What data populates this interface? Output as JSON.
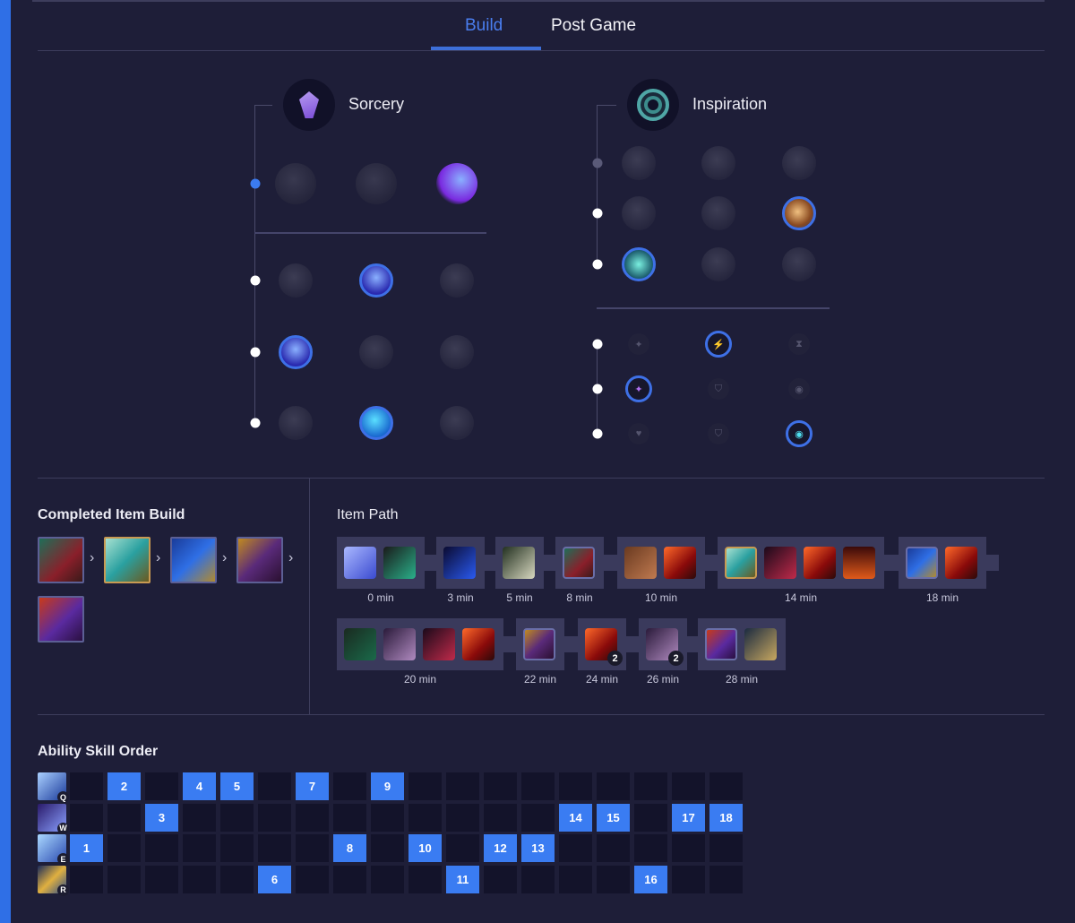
{
  "tabs": [
    {
      "label": "Build",
      "active": true
    },
    {
      "label": "Post Game",
      "active": false
    }
  ],
  "runes": {
    "primary": {
      "name": "Sorcery",
      "icon": "sorcery-tree-icon",
      "rows": [
        {
          "type": "keystone",
          "options": [
            "summon-aery-icon",
            "arcane-comet-icon",
            "phase-rush-icon"
          ],
          "selected": 2
        },
        {
          "type": "minor",
          "options": [
            "nullifying-orb-icon",
            "manaflow-band-icon",
            "nimbus-cloak-icon"
          ],
          "selected": 1
        },
        {
          "type": "minor",
          "options": [
            "transcendence-icon",
            "celerity-icon",
            "absolute-focus-icon"
          ],
          "selected": 0
        },
        {
          "type": "minor",
          "options": [
            "scorch-icon",
            "waterwalking-icon",
            "gathering-storm-icon"
          ],
          "selected": 1
        }
      ]
    },
    "secondary": {
      "name": "Inspiration",
      "icon": "inspiration-tree-icon",
      "rows": [
        {
          "options": [
            "hextech-flashtraption-icon",
            "magical-footwear-icon",
            "perfect-timing-icon"
          ],
          "selected": null
        },
        {
          "options": [
            "futures-market-icon",
            "minion-dematerializer-icon",
            "biscuit-delivery-icon"
          ],
          "selected": 2
        },
        {
          "options": [
            "cosmic-insight-icon",
            "approach-velocity-icon",
            "time-warp-tonic-icon"
          ],
          "selected": 0
        }
      ]
    },
    "shards": [
      {
        "options": [
          "adaptive-force-icon",
          "attack-speed-icon",
          "ability-haste-icon"
        ],
        "selected": 1
      },
      {
        "options": [
          "adaptive-force-icon",
          "armor-icon",
          "magic-resist-icon"
        ],
        "selected": 0
      },
      {
        "options": [
          "health-icon",
          "armor-icon",
          "magic-resist-icon"
        ],
        "selected": 2
      }
    ]
  },
  "completed_build": {
    "title": "Completed Item Build",
    "items": [
      {
        "icon": "mobility-boots-icon",
        "legendary": false
      },
      {
        "icon": "shurelyas-battlesong-icon",
        "legendary": true
      },
      {
        "icon": "staff-icon",
        "legendary": false
      },
      {
        "icon": "mask-icon",
        "legendary": false
      },
      {
        "icon": "rabadons-deathcap-icon",
        "legendary": false
      }
    ],
    "arrow": "›"
  },
  "item_path": {
    "title": "Item Path",
    "groups": [
      {
        "time": "0 min",
        "items": [
          {
            "icon": "crystal-icon"
          },
          {
            "icon": "refillable-potion-icon"
          }
        ]
      },
      {
        "time": "3 min",
        "items": [
          {
            "icon": "sapphire-icon"
          }
        ]
      },
      {
        "time": "5 min",
        "items": [
          {
            "icon": "stone-icon"
          }
        ]
      },
      {
        "time": "8 min",
        "items": [
          {
            "icon": "boots-icon",
            "bordered": true
          }
        ]
      },
      {
        "time": "10 min",
        "items": [
          {
            "icon": "tome-icon"
          },
          {
            "icon": "red-ward-icon"
          }
        ]
      },
      {
        "time": "14 min",
        "items": [
          {
            "icon": "shurelyas-battlesong-icon",
            "legendary": true
          },
          {
            "icon": "ruby-icon"
          },
          {
            "icon": "red-ward-icon"
          },
          {
            "icon": "oracle-icon"
          }
        ]
      },
      {
        "time": "18 min",
        "items": [
          {
            "icon": "staff-icon",
            "bordered": true
          },
          {
            "icon": "red-ward-icon"
          }
        ]
      },
      {
        "time": "20 min",
        "items": [
          {
            "icon": "sold-potion-icon"
          },
          {
            "icon": "dark-seal-icon"
          },
          {
            "icon": "ruby-icon"
          },
          {
            "icon": "red-ward-icon"
          }
        ]
      },
      {
        "time": "22 min",
        "items": [
          {
            "icon": "mask-icon",
            "bordered": true
          }
        ]
      },
      {
        "time": "24 min",
        "items": [
          {
            "icon": "red-ward-icon",
            "count": "2"
          }
        ]
      },
      {
        "time": "26 min",
        "items": [
          {
            "icon": "dark-seal-icon",
            "count": "2"
          }
        ]
      },
      {
        "time": "28 min",
        "items": [
          {
            "icon": "rabadons-deathcap-icon",
            "bordered": true
          },
          {
            "icon": "stopwatch-icon"
          }
        ]
      }
    ]
  },
  "skill_order": {
    "title": "Ability Skill Order",
    "abilities": [
      {
        "key": "Q",
        "icon": "ability-q-icon",
        "levels": [
          2,
          4,
          5,
          7,
          9
        ]
      },
      {
        "key": "W",
        "icon": "ability-w-icon",
        "levels": [
          3,
          14,
          15,
          17,
          18
        ]
      },
      {
        "key": "E",
        "icon": "ability-e-icon",
        "levels": [
          1,
          8,
          10,
          12,
          13
        ]
      },
      {
        "key": "R",
        "icon": "ability-r-icon",
        "levels": [
          6,
          11,
          16
        ]
      }
    ],
    "total_levels": 18
  },
  "colors": {
    "accent": "#3a7cf2",
    "background": "#1e1e38",
    "legendary_border": "#c89a52"
  }
}
